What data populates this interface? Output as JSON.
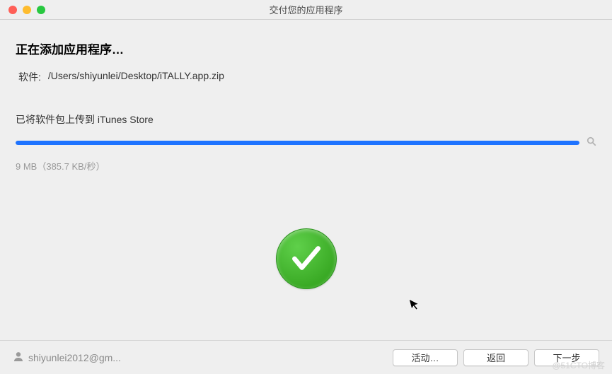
{
  "window": {
    "title": "交付您的应用程序"
  },
  "heading": "正在添加应用程序…",
  "file": {
    "label": "软件:",
    "path": "/Users/shiyunlei/Desktop/iTALLY.app.zip"
  },
  "status": "已将软件包上传到 iTunes Store",
  "progress": {
    "percent": 100,
    "speed_text": "9 MB（385.7 KB/秒）"
  },
  "footer": {
    "user": "shiyunlei2012@gm...",
    "activity_label": "活动…",
    "back_label": "返回",
    "next_label": "下一步"
  },
  "watermark": "@51CTO博客"
}
